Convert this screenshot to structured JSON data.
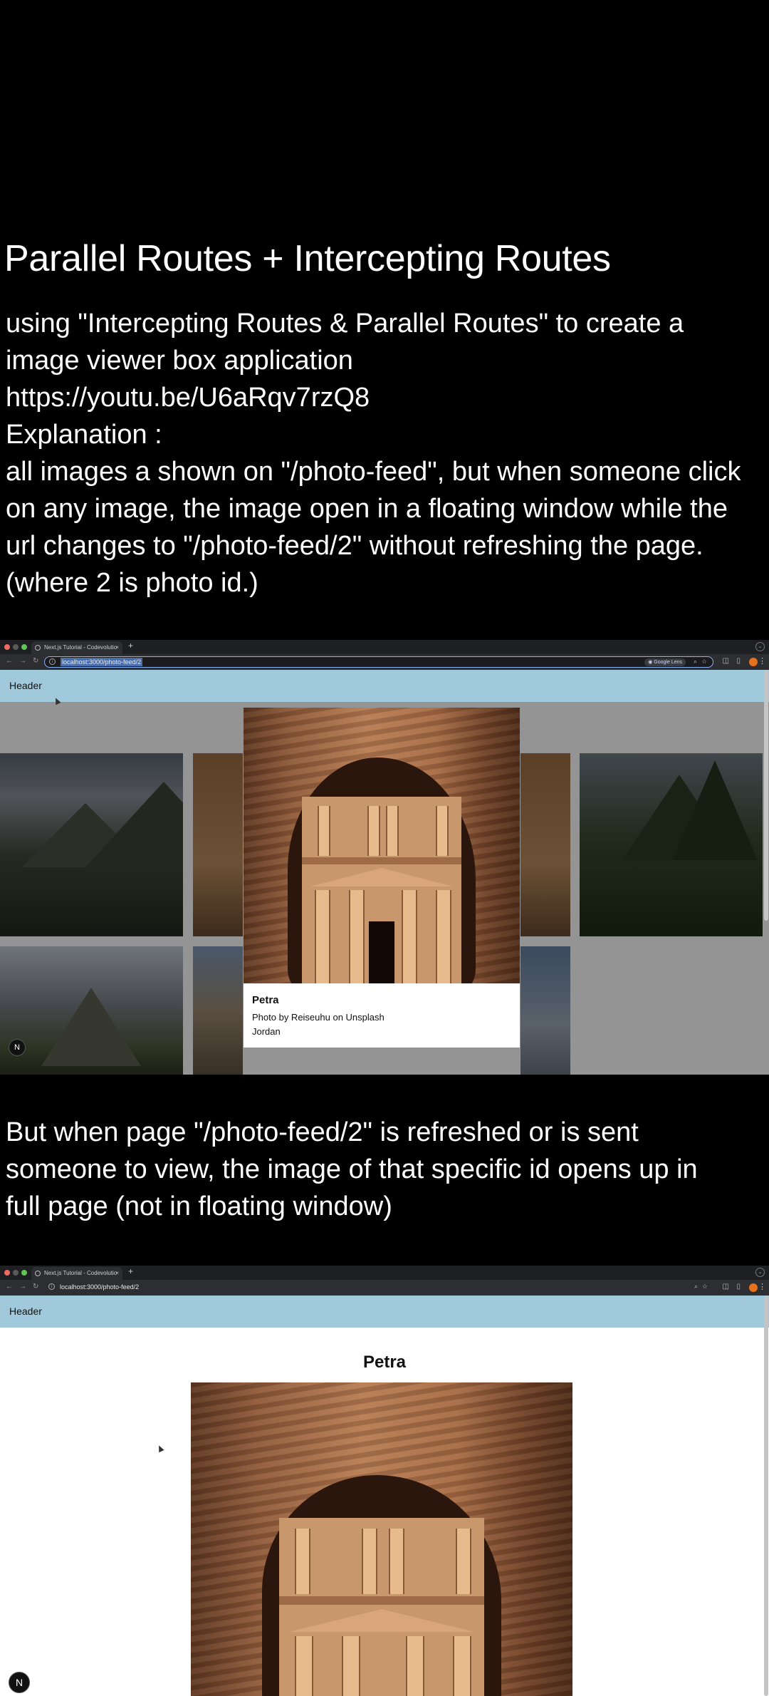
{
  "title": "Parallel Routes + Intercepting Routes",
  "intro_lines": [
    "using \"Intercepting Routes & Parallel Routes\" to create a",
    "image viewer box application",
    "https://youtu.be/U6aRqv7rzQ8",
    "Explanation :",
    "all images a shown on \"/photo-feed\", but when someone click",
    "on any image, the image open in a floating window while the",
    "url changes to \"/photo-feed/2\" without refreshing the page.",
    "(where 2 is photo id.)"
  ],
  "browser1": {
    "tab_title": "Next.js Tutorial - Codevolutio",
    "url": "localhost:3000/photo-feed/2",
    "lens_label": "Google Lens",
    "header_label": "Header",
    "modal": {
      "title": "Petra",
      "credit": "Photo by Reiseuhu on Unsplash",
      "location": "Jordan"
    }
  },
  "refresh_note_lines": [
    "But when page \"/photo-feed/2\" is refreshed or is sent",
    "someone to view, the image of that specific id opens up in",
    "full page (not in floating window)"
  ],
  "browser2": {
    "tab_title": "Next.js Tutorial - Codevolutio",
    "url": "localhost:3000/photo-feed/2",
    "header_label": "Header",
    "photo_title": "Petra"
  },
  "next_badge_glyph": "N",
  "colors": {
    "background": "#000000",
    "app_header": "#a1c9dc",
    "url_focus": "#8ab4f8",
    "profile": "#e8711c"
  },
  "icons": [
    "close-icon",
    "plus-icon",
    "back-arrow-icon",
    "forward-arrow-icon",
    "reload-icon",
    "info-icon",
    "google-lens-icon",
    "search-icon",
    "star-icon",
    "extensions-icon",
    "profile-icon",
    "kebab-icon",
    "nextjs-badge-icon"
  ]
}
